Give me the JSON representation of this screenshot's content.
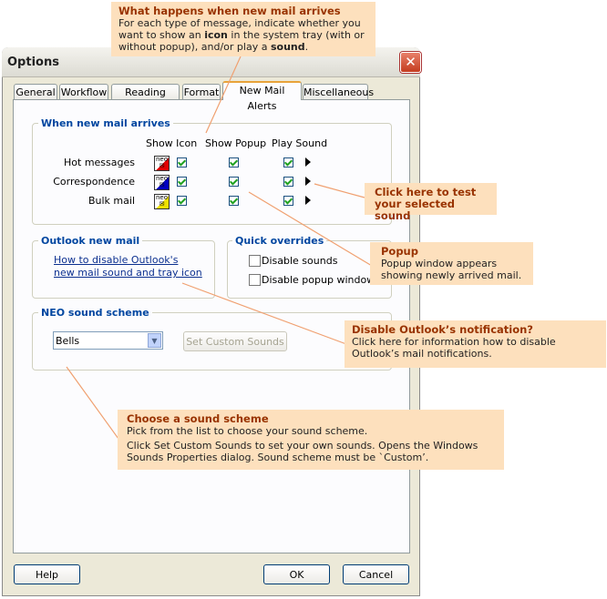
{
  "window": {
    "title": "Options",
    "close_icon": "close-icon"
  },
  "tabs": [
    {
      "label": "General"
    },
    {
      "label": "Workflow"
    },
    {
      "label": "Reading Pane"
    },
    {
      "label": "Format"
    },
    {
      "label": "New Mail Alerts",
      "active": true
    },
    {
      "label": "Miscellaneous"
    }
  ],
  "arrives": {
    "title": "When new mail arrives",
    "col_icon": "Show Icon",
    "col_popup": "Show Popup",
    "col_sound": "Play Sound",
    "rows": [
      {
        "label": "Hot messages",
        "color": "#e00000",
        "icon": true,
        "popup": true,
        "sound": true
      },
      {
        "label": "Correspondence",
        "color": "#0000c0",
        "icon": true,
        "popup": true,
        "sound": true
      },
      {
        "label": "Bulk mail",
        "color": "#f0e000",
        "icon": true,
        "popup": true,
        "sound": true
      }
    ]
  },
  "outlook": {
    "title": "Outlook new mail",
    "link_line1": "How to disable Outlook's",
    "link_line2": "new mail sound and tray icon"
  },
  "overrides": {
    "title": "Quick overrides",
    "disable_sounds": "Disable sounds",
    "disable_popup": "Disable popup window"
  },
  "scheme": {
    "title": "NEO sound scheme",
    "selected": "Bells",
    "custom_button": "Set Custom Sounds"
  },
  "buttons": {
    "help": "Help",
    "ok": "OK",
    "cancel": "Cancel"
  },
  "callouts": {
    "what": {
      "title": "What happens when new mail arrives",
      "t1": "For each type of message, indicate whether you",
      "t2a": "want to show an ",
      "t2b": "icon",
      "t2c": " in the system tray (with or",
      "t3a": "without popup), and/or play a ",
      "t3b": "sound",
      "t3c": "."
    },
    "test": {
      "l1": "Click here to test",
      "l2": "your selected sound"
    },
    "popup": {
      "title": "Popup",
      "l1": "Popup window appears",
      "l2": "showing newly arrived mail."
    },
    "disable": {
      "title": "Disable Outlook’s notification?",
      "l1": "Click here for information how to disable",
      "l2": "Outlook’s mail notifications."
    },
    "choose": {
      "title": "Choose a sound scheme",
      "l1": "Pick from the list to choose your sound scheme.",
      "l2": "Click Set Custom Sounds to set your own sounds. Opens the Windows",
      "l3": "Sounds Properties dialog. Sound scheme must be `Custom’."
    }
  },
  "colors": {
    "callout_bg": "#fde0bd",
    "callout_title": "#993300",
    "group_title": "#0046a0"
  }
}
